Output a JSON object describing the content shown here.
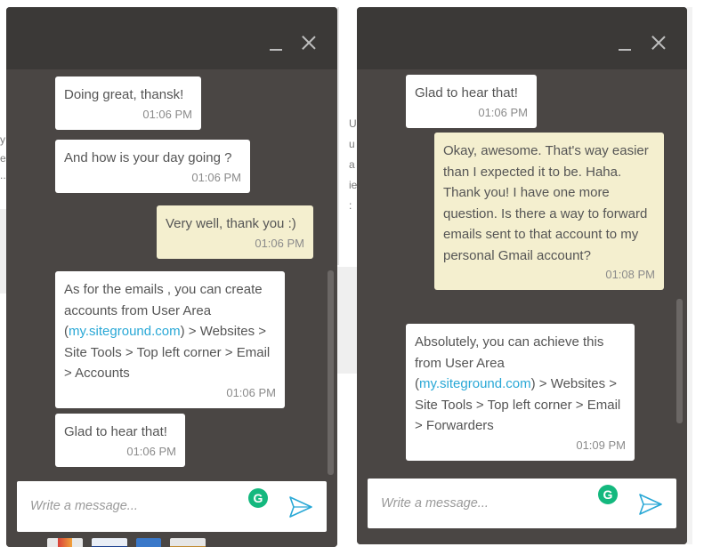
{
  "background_fragments": {
    "left": [
      "y",
      "e",
      "..."
    ],
    "right": [
      "U",
      "u",
      "a",
      "ie",
      ":"
    ]
  },
  "composer_placeholder": "Write a message...",
  "grammarly_glyph": "G",
  "icons": {
    "minimize": "minimize-icon",
    "close": "close-icon",
    "grammarly": "grammarly-icon",
    "send": "send-icon",
    "payment_cards": [
      "mastercard-icon",
      "visa-icon",
      "amex-icon",
      "card-icon"
    ]
  },
  "colors": {
    "panel_bg": "#4a4644",
    "header_bg": "#3b3937",
    "agent_bubble": "#ffffff",
    "user_bubble": "#f4efcf",
    "link": "#29a8d6",
    "grammarly": "#14b87e",
    "send": "#29a8d6"
  },
  "left_chat": {
    "messages": [
      {
        "from": "agent",
        "text": "Doing great, thansk!",
        "time": "01:06 PM"
      },
      {
        "from": "agent",
        "text": "And how is your day going ?",
        "time": "01:06 PM"
      },
      {
        "from": "user",
        "text": "Very well, thank you :)",
        "time": "01:06 PM"
      },
      {
        "from": "agent",
        "text_before": "As for the emails , you can create accounts from User Area (",
        "link": "my.siteground.com",
        "text_after": ") > Websites > Site Tools > Top left corner > Email > Accounts",
        "time": "01:06 PM"
      },
      {
        "from": "agent",
        "text": "Glad to hear that!",
        "time": "01:06 PM"
      }
    ]
  },
  "right_chat": {
    "messages": [
      {
        "from": "agent",
        "text": "Glad to hear that!",
        "time": "01:06 PM"
      },
      {
        "from": "user",
        "text": "Okay, awesome. That's way easier than I expected it to be. Haha. Thank you! I have one more question. Is there a way to forward emails sent to that account to my personal Gmail account?",
        "time": "01:08 PM"
      },
      {
        "from": "agent",
        "text_before": "Absolutely, you can achieve this from User Area (",
        "link": "my.siteground.com",
        "text_after": ") > Websites > Site Tools > Top left corner > Email > Forwarders",
        "time": "01:09 PM"
      }
    ]
  }
}
